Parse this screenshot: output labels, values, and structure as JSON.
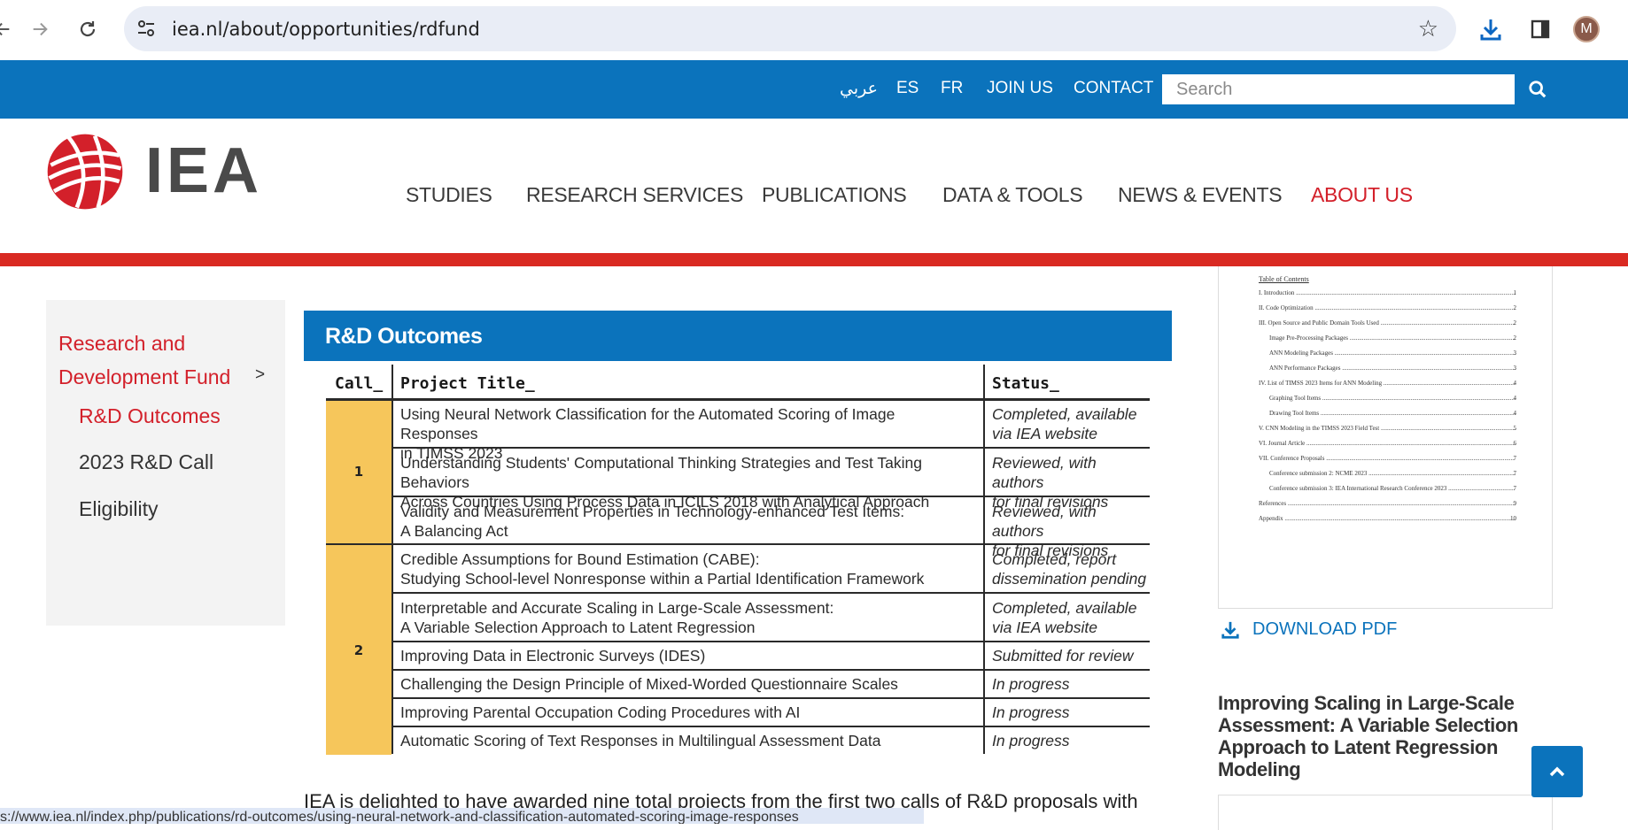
{
  "browser": {
    "url": "iea.nl/about/opportunities/rdfund",
    "profile_initial": "M",
    "status_url": "s://www.iea.nl/index.php/publications/rd-outcomes/using-neural-network-and-classification-automated-scoring-image-responses"
  },
  "topbar": {
    "links": [
      "عربي",
      "ES",
      "FR",
      "JOIN US",
      "CONTACT"
    ],
    "search_placeholder": "Search"
  },
  "header": {
    "logo_text": "IEA",
    "nav": [
      "STUDIES",
      "RESEARCH SERVICES",
      "PUBLICATIONS",
      "DATA & TOOLS",
      "NEWS & EVENTS",
      "ABOUT US"
    ]
  },
  "sidebar": {
    "parent_line1": "Research and",
    "parent_line2": "Development Fund",
    "arrow": ">",
    "items": [
      "R&D Outcomes",
      "2023 R&D Call",
      "Eligibility"
    ]
  },
  "main": {
    "banner_title": "R&D Outcomes",
    "table": {
      "headers": {
        "call": "Call_",
        "title": "Project Title_",
        "status": "Status_"
      },
      "call_groups": [
        "1",
        "2"
      ],
      "rows": [
        {
          "title1": "Using Neural Network Classification for the Automated Scoring of Image Responses",
          "title2": "in TIMSS 2023",
          "status1": "Completed, available",
          "status2": "via IEA website"
        },
        {
          "title1": "Understanding Students' Computational Thinking Strategies and Test Taking Behaviors",
          "title2": "Across Countries Using Process Data in ICILS 2018 with Analytical Approach",
          "status1": "Reviewed, with authors",
          "status2": "for final revisions"
        },
        {
          "title1": "Validity and Measurement Properties in Technology-enhanced Test Items:",
          "title2": "A Balancing Act",
          "status1": "Reviewed, with authors",
          "status2": "for final revisions"
        },
        {
          "title1": "Credible Assumptions for Bound Estimation (CABE):",
          "title2": "Studying School-level Nonresponse within a Partial Identification Framework",
          "status1": "Completed, report",
          "status2": "dissemination pending"
        },
        {
          "title1": "Interpretable and Accurate Scaling in Large-Scale Assessment:",
          "title2": "A Variable Selection Approach to Latent Regression",
          "status1": "Completed, available",
          "status2": "via IEA website"
        },
        {
          "title1": "Improving Data in Electronic Surveys (IDES)",
          "title2": "",
          "status1": "Submitted for review",
          "status2": ""
        },
        {
          "title1": "Challenging the Design Principle of Mixed-Worded Questionnaire Scales",
          "title2": "",
          "status1": "In progress",
          "status2": ""
        },
        {
          "title1": "Improving Parental Occupation Coding Procedures with AI",
          "title2": "",
          "status1": "In progress",
          "status2": ""
        },
        {
          "title1": "Automatic Scoring of Text Responses in Multilingual Assessment Data",
          "title2": "",
          "status1": "In progress",
          "status2": ""
        }
      ]
    },
    "intro": "IEA is delighted to have awarded nine total projects from the first two calls of R&D proposals with"
  },
  "right": {
    "toc_title": "Table of Contents",
    "toc": [
      {
        "text": "I.    Introduction",
        "page": "1",
        "indent": false
      },
      {
        "text": "II.   Code Optimization",
        "page": "2",
        "indent": false
      },
      {
        "text": "III.  Open Source and Public Domain Tools Used",
        "page": "2",
        "indent": false
      },
      {
        "text": "Image Pre-Processing Packages",
        "page": "2",
        "indent": true
      },
      {
        "text": "ANN Modeling Packages",
        "page": "3",
        "indent": true
      },
      {
        "text": "ANN Performance Packages",
        "page": "3",
        "indent": true
      },
      {
        "text": "IV.  List of TIMSS 2023 Items for ANN Modeling",
        "page": "4",
        "indent": false
      },
      {
        "text": "Graphing Tool Items",
        "page": "4",
        "indent": true
      },
      {
        "text": "Drawing Tool Items",
        "page": "4",
        "indent": true
      },
      {
        "text": "V.   CNN Modeling in the TIMSS 2023 Field Test",
        "page": "5",
        "indent": false
      },
      {
        "text": "VI.  Journal Article",
        "page": "6",
        "indent": false
      },
      {
        "text": "VII. Conference Proposals",
        "page": "7",
        "indent": false
      },
      {
        "text": "Conference submission 2: NCME 2023",
        "page": "7",
        "indent": true
      },
      {
        "text": "Conference submission 3: IEA International Research Conference 2023",
        "page": "7",
        "indent": true
      },
      {
        "text": "References",
        "page": "9",
        "indent": false
      },
      {
        "text": "Appendix",
        "page": "10",
        "indent": false
      }
    ],
    "download_label": "DOWNLOAD PDF",
    "related_title": "Improving Scaling in Large-Scale Assessment: A Variable Selection Approach to Latent Regression Modeling"
  }
}
